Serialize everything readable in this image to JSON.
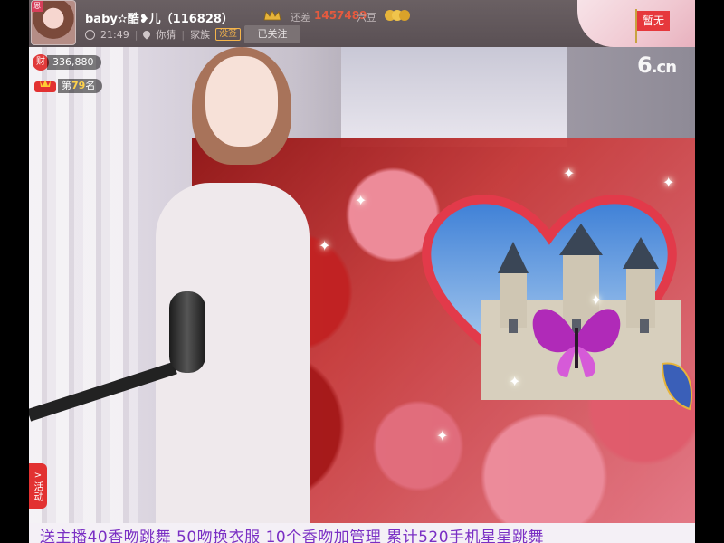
{
  "header": {
    "anchor_name": "baby✫酷❥儿（116828）",
    "gap_label": "还差",
    "gap_value": "1457489",
    "gap_unit": "六豆",
    "time": "21:49",
    "location": "你猜",
    "family_label": "家族",
    "family_tag": "没签",
    "follow_label": "已关注",
    "avatar_corner": "恩",
    "status_tag": "暂无"
  },
  "video": {
    "watermark_main": "6",
    "watermark_suffix": ".cn",
    "wealth_icon": "财",
    "wealth_value": "336,880",
    "rank_prefix": "第",
    "rank_value": "79",
    "rank_suffix": "名",
    "activity_arrow": ">",
    "activity_label": "活动"
  },
  "ticker": {
    "text": "送主播40香吻跳舞 50吻换衣服 10个香吻加管理 累计520手机星星跳舞"
  },
  "colors": {
    "topbar": "#5e5558",
    "accent_red": "#e6383c",
    "gap_value": "#e55a3f",
    "ticker_text": "#7a2fc4"
  }
}
